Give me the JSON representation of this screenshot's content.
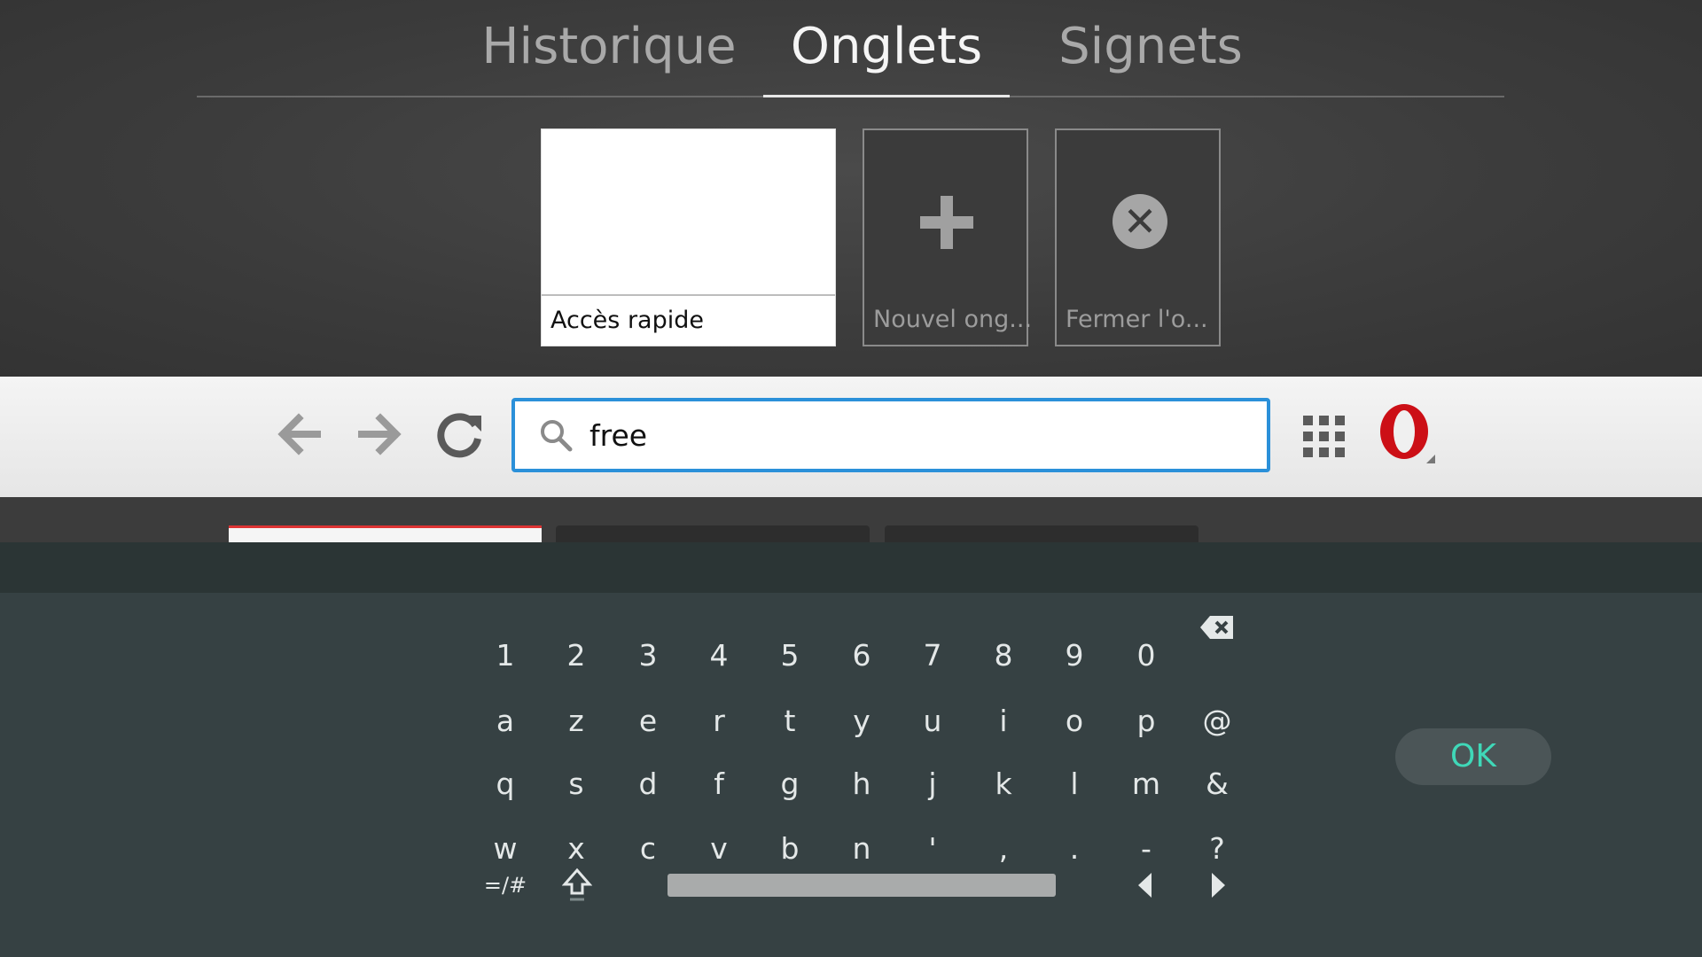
{
  "tabs": {
    "history": "Historique",
    "tabs": "Onglets",
    "bookmarks": "Signets"
  },
  "cards": {
    "quick_access": "Accès rapide",
    "new_tab": "Nouvel ong...",
    "close_tab": "Fermer l'o..."
  },
  "address_bar": {
    "value": "free"
  },
  "keyboard": {
    "row1": [
      "1",
      "2",
      "3",
      "4",
      "5",
      "6",
      "7",
      "8",
      "9",
      "0"
    ],
    "row2": [
      "a",
      "z",
      "e",
      "r",
      "t",
      "y",
      "u",
      "i",
      "o",
      "p",
      "@"
    ],
    "row3": [
      "q",
      "s",
      "d",
      "f",
      "g",
      "h",
      "j",
      "k",
      "l",
      "m",
      "&"
    ],
    "row4": [
      "w",
      "x",
      "c",
      "v",
      "b",
      "n",
      "'",
      ",",
      ".",
      "-",
      "?"
    ],
    "symbols_key": "=/#",
    "ok": "OK"
  },
  "colors": {
    "accent_blue": "#2b90d9",
    "ok_text": "#3fd8b8",
    "opera_red": "#cc0f16"
  },
  "icons": [
    "back-arrow-icon",
    "forward-arrow-icon",
    "reload-icon",
    "search-icon",
    "grid-icon",
    "opera-logo-icon",
    "plus-icon",
    "close-circle-icon",
    "backspace-icon",
    "shift-icon",
    "left-arrow-icon",
    "right-arrow-icon"
  ]
}
